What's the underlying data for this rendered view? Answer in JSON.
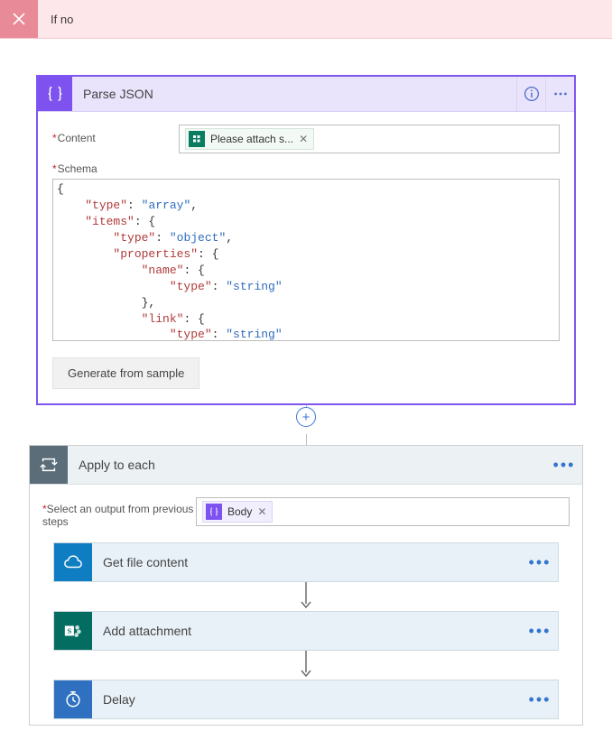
{
  "ifno": {
    "title": "If no"
  },
  "parseJson": {
    "title": "Parse JSON",
    "contentLabel": "Content",
    "token": {
      "label": "Please attach s..."
    },
    "schemaLabel": "Schema",
    "schema": {
      "l1a": "\"type\"",
      "l1b": "\"array\"",
      "l2a": "\"items\"",
      "l3a": "\"type\"",
      "l3b": "\"object\"",
      "l4a": "\"properties\"",
      "l5a": "\"name\"",
      "l6a": "\"type\"",
      "l6b": "\"string\"",
      "l8a": "\"link\"",
      "l9a": "\"type\"",
      "l9b": "\"string\""
    },
    "generateBtn": "Generate from sample"
  },
  "applyToEach": {
    "title": "Apply to each",
    "selectLabel": "Select an output from previous steps",
    "token": {
      "label": "Body"
    },
    "steps": {
      "getFile": "Get file content",
      "addAttachment": "Add attachment",
      "delay": "Delay"
    }
  }
}
